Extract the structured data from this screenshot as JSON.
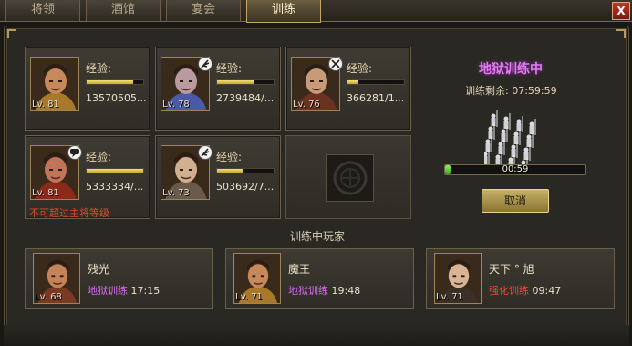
{
  "tabs": [
    {
      "label": "将领"
    },
    {
      "label": "酒馆"
    },
    {
      "label": "宴会"
    },
    {
      "label": "训练",
      "active": true
    }
  ],
  "close_label": "X",
  "slots": [
    {
      "level": "Lv. 81",
      "exp_label": "经验:",
      "exp_value": "13570505...",
      "exp_progress": 0.82,
      "status_icon": "none",
      "skin": "#c8895a",
      "armor": "#a8792a"
    },
    {
      "level": "Lv. 78",
      "exp_label": "经验:",
      "exp_value": "2739484/...",
      "exp_progress": 0.65,
      "status_icon": "feather-icon",
      "skin": "#b89aa0",
      "armor": "#4a5aa8"
    },
    {
      "level": "Lv. 76",
      "exp_label": "经验:",
      "exp_value": "366281/1...",
      "exp_progress": 0.2,
      "status_icon": "crossed-swords-icon",
      "skin": "#c89a78",
      "armor": "#6a3220"
    },
    {
      "level": "Lv. 81",
      "exp_label": "经验:",
      "exp_value": "5333334/...",
      "exp_progress": 1.0,
      "status_icon": "speech-bubble-icon",
      "skin": "#c0745a",
      "armor": "#8a2a1a",
      "warning": "不可超过主将等级"
    },
    {
      "level": "Lv. 73",
      "exp_label": "经验:",
      "exp_value": "503692/7...",
      "exp_progress": 0.45,
      "status_icon": "feather-icon",
      "skin": "#d0b090",
      "armor": "#6a5a4a"
    }
  ],
  "hell": {
    "title": "地狱训练中",
    "remaining_label": "训练剩余:",
    "remaining_time": "07:59:59",
    "progress_text": "00:59",
    "progress": 0.02,
    "cancel_label": "取消"
  },
  "section_title": "训练中玩家",
  "players": [
    {
      "name": "残光",
      "level": "Lv. 68",
      "mode": "地狱训练",
      "mode_type": "hell",
      "time": "17:15",
      "skin": "#c4845a",
      "armor": "#7a3a22"
    },
    {
      "name": "魔王",
      "level": "Lv. 71",
      "mode": "地狱训练",
      "mode_type": "hell",
      "time": "19:48",
      "skin": "#c8895a",
      "armor": "#a8792a"
    },
    {
      "name": "天下 ° 旭",
      "level": "Lv. 71",
      "mode": "强化训练",
      "mode_type": "strong",
      "time": "09:47",
      "skin": "#d8b494",
      "armor": "#3a3028"
    }
  ],
  "colors": {
    "hell_mode": "#d86cf0",
    "strong_mode": "#ee4a32",
    "exp_fill": "#e0c850",
    "progress_fill": "#5cd03a",
    "warning": "#e04a2a"
  }
}
